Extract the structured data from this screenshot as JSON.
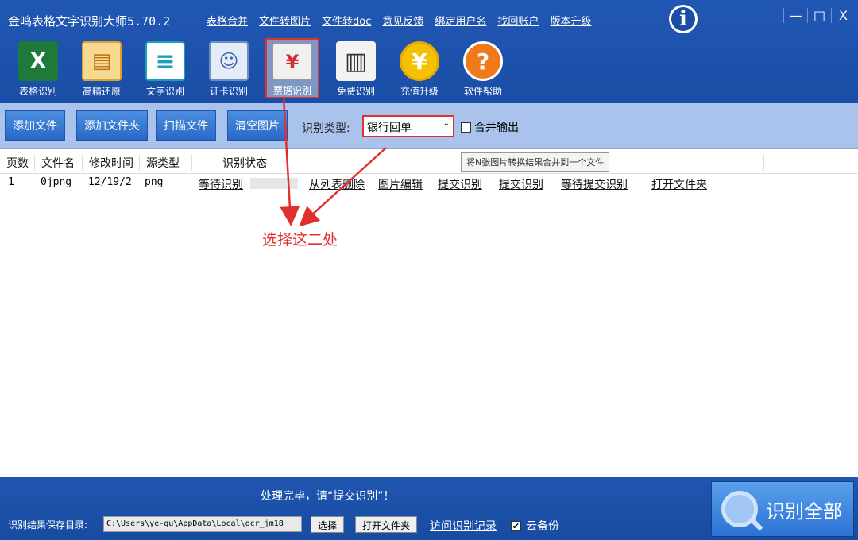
{
  "app": {
    "title": "金鸣表格文字识别大师5.70.2"
  },
  "top_links": [
    "表格合并",
    "文件转图片",
    "文件转doc",
    "意见反馈",
    "绑定用户名",
    "找回账户",
    "版本升级"
  ],
  "window_controls": {
    "min": "—",
    "max": "□",
    "close": "X"
  },
  "tools": [
    {
      "label": "表格识别",
      "icon": "excel-icon",
      "glyph": "X",
      "bg": "#1e7a3a"
    },
    {
      "label": "高精还原",
      "icon": "document-restore-icon",
      "glyph": "▤",
      "bg": "#f0b040"
    },
    {
      "label": "文字识别",
      "icon": "text-document-icon",
      "glyph": "≡",
      "bg": "#1a9fb8"
    },
    {
      "label": "证卡识别",
      "icon": "id-card-icon",
      "glyph": "☺",
      "bg": "#d8e4f4"
    },
    {
      "label": "票据识别",
      "icon": "receipt-icon",
      "glyph": "¥",
      "bg": "#e8e8e8"
    },
    {
      "label": "免费识别",
      "icon": "book-icon",
      "glyph": "▥",
      "bg": "#f3f3f3"
    },
    {
      "label": "充值升级",
      "icon": "yuan-coin-icon",
      "glyph": "¥",
      "bg": "#f5c000"
    },
    {
      "label": "软件帮助",
      "icon": "help-icon",
      "glyph": "?",
      "bg": "#f07a1a"
    }
  ],
  "toolbar": {
    "add_file": "添加文件",
    "add_folder": "添加文件夹",
    "scan_file": "扫描文件",
    "clear_images": "清空图片",
    "type_label": "识别类型:",
    "type_value": "银行回单",
    "merge_label": "合并输出",
    "merge_tooltip": "将N张图片转换结果合并到一个文件"
  },
  "table": {
    "headers": [
      "页数",
      "文件名",
      "修改时间",
      "源类型",
      "识别状态"
    ],
    "rows": [
      {
        "page": "1",
        "filename": "0jpng",
        "modified": "12/19/2",
        "source_type": "png",
        "status": "等待识别",
        "actions": [
          "从列表删除",
          "图片编辑",
          "提交识别",
          "提交识别",
          "等待提交识别",
          "打开文件夹"
        ]
      }
    ]
  },
  "annotation": "选择这二处",
  "bottom": {
    "status_message": "处理完毕，请“提交识别”！",
    "save_dir_label": "识别结果保存目录:",
    "save_dir_value": "C:\\Users\\ye-gu\\AppData\\Local\\ocr_jm18",
    "select_btn": "选择",
    "open_folder_btn": "打开文件夹",
    "history_link": "访问识别记录",
    "cloud_backup": "云备份",
    "cloud_backup_checked": "✔",
    "recognize_all": "识别全部"
  },
  "colors": {
    "accent": "#1a4ea6",
    "highlight": "#e03030",
    "toolbar_bg": "#a9c3ed"
  }
}
